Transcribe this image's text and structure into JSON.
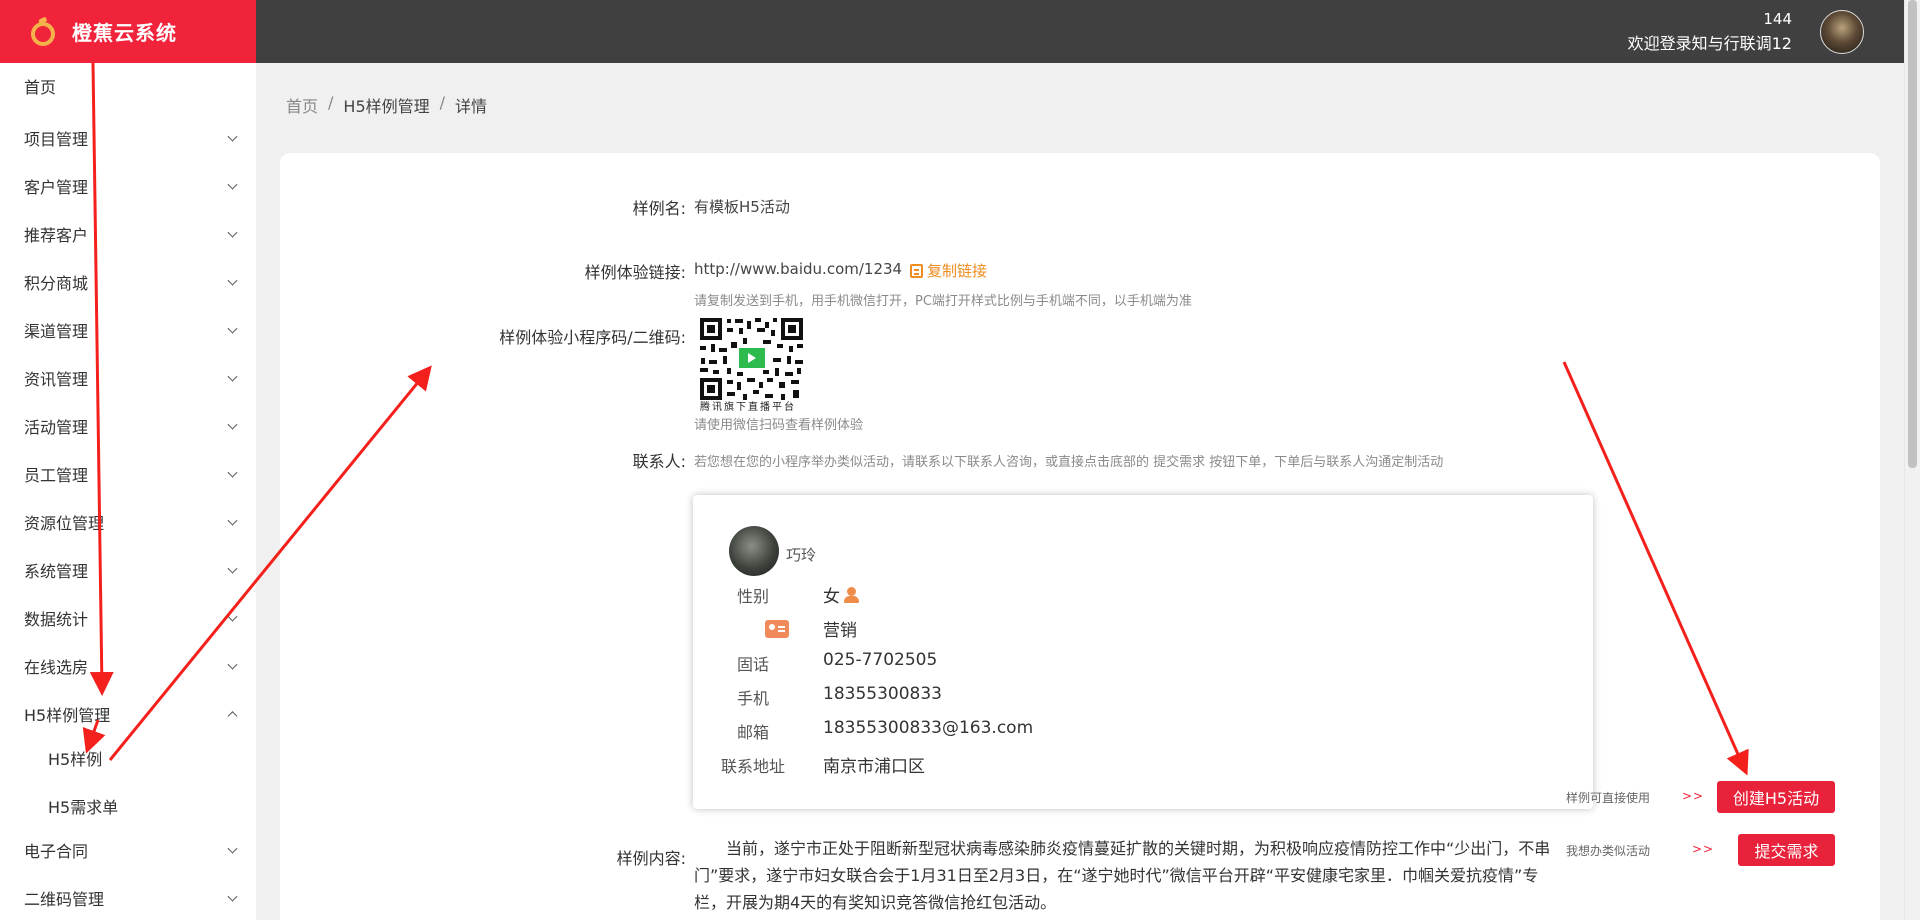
{
  "app": {
    "title": "橙蕉云系统"
  },
  "user": {
    "count": "144",
    "welcome": "欢迎登录知与行联调12"
  },
  "sidebar": {
    "items": [
      {
        "label": "首页"
      },
      {
        "label": "项目管理"
      },
      {
        "label": "客户管理"
      },
      {
        "label": "推荐客户"
      },
      {
        "label": "积分商城"
      },
      {
        "label": "渠道管理"
      },
      {
        "label": "资讯管理"
      },
      {
        "label": "活动管理"
      },
      {
        "label": "员工管理"
      },
      {
        "label": "资源位管理"
      },
      {
        "label": "系统管理"
      },
      {
        "label": "数据统计"
      },
      {
        "label": "在线选房"
      },
      {
        "label": "H5样例管理"
      },
      {
        "label": "H5样例"
      },
      {
        "label": "H5需求单"
      },
      {
        "label": "电子合同"
      },
      {
        "label": "二维码管理"
      }
    ]
  },
  "breadcrumb": {
    "home": "首页",
    "section": "H5样例管理",
    "current": "详情",
    "sep": "/"
  },
  "detail": {
    "name_label": "样例名:",
    "name_value": "有模板H5活动",
    "link_label": "样例体验链接:",
    "link_value": "http://www.baidu.com/1234",
    "copy_label": "复制链接",
    "link_hint": "请复制发送到手机，用手机微信打开，PC端打开样式比例与手机端不同，以手机端为准",
    "qr_label": "样例体验小程序码/二维码:",
    "qr_caption": "腾讯旗下直播平台",
    "qr_hint": "请使用微信扫码查看样例体验",
    "contact_label": "联系人:",
    "contact_hint": "若您想在您的小程序举办类似活动，请联系以下联系人咨询，或直接点击底部的 提交需求 按钮下单，下单后与联系人沟通定制活动",
    "content_label": "样例内容:",
    "content_text": "当前，遂宁市正处于阻断新型冠状病毒感染肺炎疫情蔓延扩散的关键时期，为积极响应疫情防控工作中“少出门，不串门”要求，遂宁市妇女联合会于1月31日至2月3日，在“遂宁她时代”微信平台开辟“平安健康宅家里．巾帼关爱抗疫情”专栏，开展为期4天的有奖知识竞答微信抢红包活动。"
  },
  "contact": {
    "name": "巧玲",
    "gender_label": "性别",
    "gender_value": "女",
    "role_value": "营销",
    "phone_label": "固话",
    "phone_value": "025-7702505",
    "mobile_label": "手机",
    "mobile_value": "18355300833",
    "email_label": "邮箱",
    "email_value": "18355300833@163.com",
    "address_label": "联系地址",
    "address_value": "南京市浦口区"
  },
  "actions": {
    "create_hint": "样例可直接使用",
    "create_arrow": ">>",
    "create_label": "创建H5活动",
    "submit_hint": "我想办类似活动",
    "submit_arrow": ">>",
    "submit_label": "提交需求"
  },
  "colors": {
    "brand": "#f0233b",
    "topbar": "#404040",
    "accent": "#ef8c22",
    "annotation": "#f3201c"
  }
}
